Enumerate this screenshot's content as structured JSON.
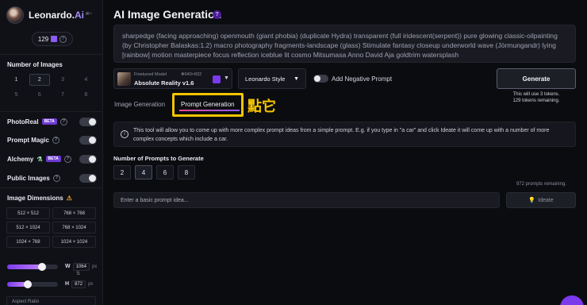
{
  "brand": {
    "name": "Leonardo.",
    "name_suffix": "Ai"
  },
  "sidebar": {
    "tokens": "129",
    "number_of_images": {
      "title": "Number of Images",
      "options": [
        "1",
        "2",
        "3",
        "4",
        "5",
        "6",
        "7",
        "8"
      ],
      "selected": "2"
    },
    "toggles": [
      {
        "label": "PhotoReal",
        "badge": "BETA"
      },
      {
        "label": "Prompt Magic"
      },
      {
        "label": "Alchemy",
        "badge": "BETA"
      },
      {
        "label": "Public Images"
      }
    ],
    "image_dimensions": {
      "title": "Image Dimensions",
      "options": [
        "512 × 512",
        "768 × 768",
        "512 × 1024",
        "768 × 1024",
        "1024 × 768",
        "1024 × 1024"
      ]
    },
    "width": {
      "label": "W",
      "value": "1064",
      "unit": "px",
      "slider_fraction": 0.72
    },
    "height": {
      "label": "H",
      "value": "872",
      "unit": "px",
      "slider_fraction": 0.38
    },
    "aspect_ratio_label": "Aspect Ratio"
  },
  "main": {
    "title": "AI Image Generation",
    "help": "?",
    "prompt_text": "sharpedge (facing approaching) openmouth (giant phobia) (duplicate Hydra) transparent (full iridescent(serpent)) pure glowing classic-oilpainting (by Christopher Balaskas:1.2) macro photography fragments-landscape (glass) Stimulate fantasy closeup underworld wave (Jörmungandr) lying [rainbow] motion masterpiece focus reflection iceblue lit cosmo Mitsumasa Anno David Aja goldtrim watersplash",
    "model": {
      "caption": "Finetuned Model",
      "size": "640×832",
      "name": "Absolute Reality v1.6"
    },
    "style": "Leonardo Style",
    "negative_prompt_label": "Add Negative Prompt",
    "generate": {
      "label": "Generate",
      "note1": "This will use 3 tokens.",
      "note2": "129 tokens remaining."
    },
    "tabs": [
      "Image Generation",
      "Prompt Generation"
    ],
    "active_tab": "Prompt Generation",
    "annotation": "點它",
    "info_text": "This tool will allow you to come up with more complex prompt ideas from a simple prompt. E.g. if you type in \"a car\" and click Ideate it will come up with a number of more complex concepts which include a car.",
    "prompts_to_generate": {
      "label": "Number of Prompts to Generate",
      "options": [
        "2",
        "4",
        "6",
        "8"
      ],
      "selected": "4"
    },
    "remaining": "972 prompts remaining.",
    "basic_prompt_placeholder": "Enter a basic prompt idea...",
    "ideate_label": "Ideate"
  },
  "colors": {
    "accent": "#7c3aed",
    "highlight": "#f5c400",
    "background": "#0b0c10"
  }
}
